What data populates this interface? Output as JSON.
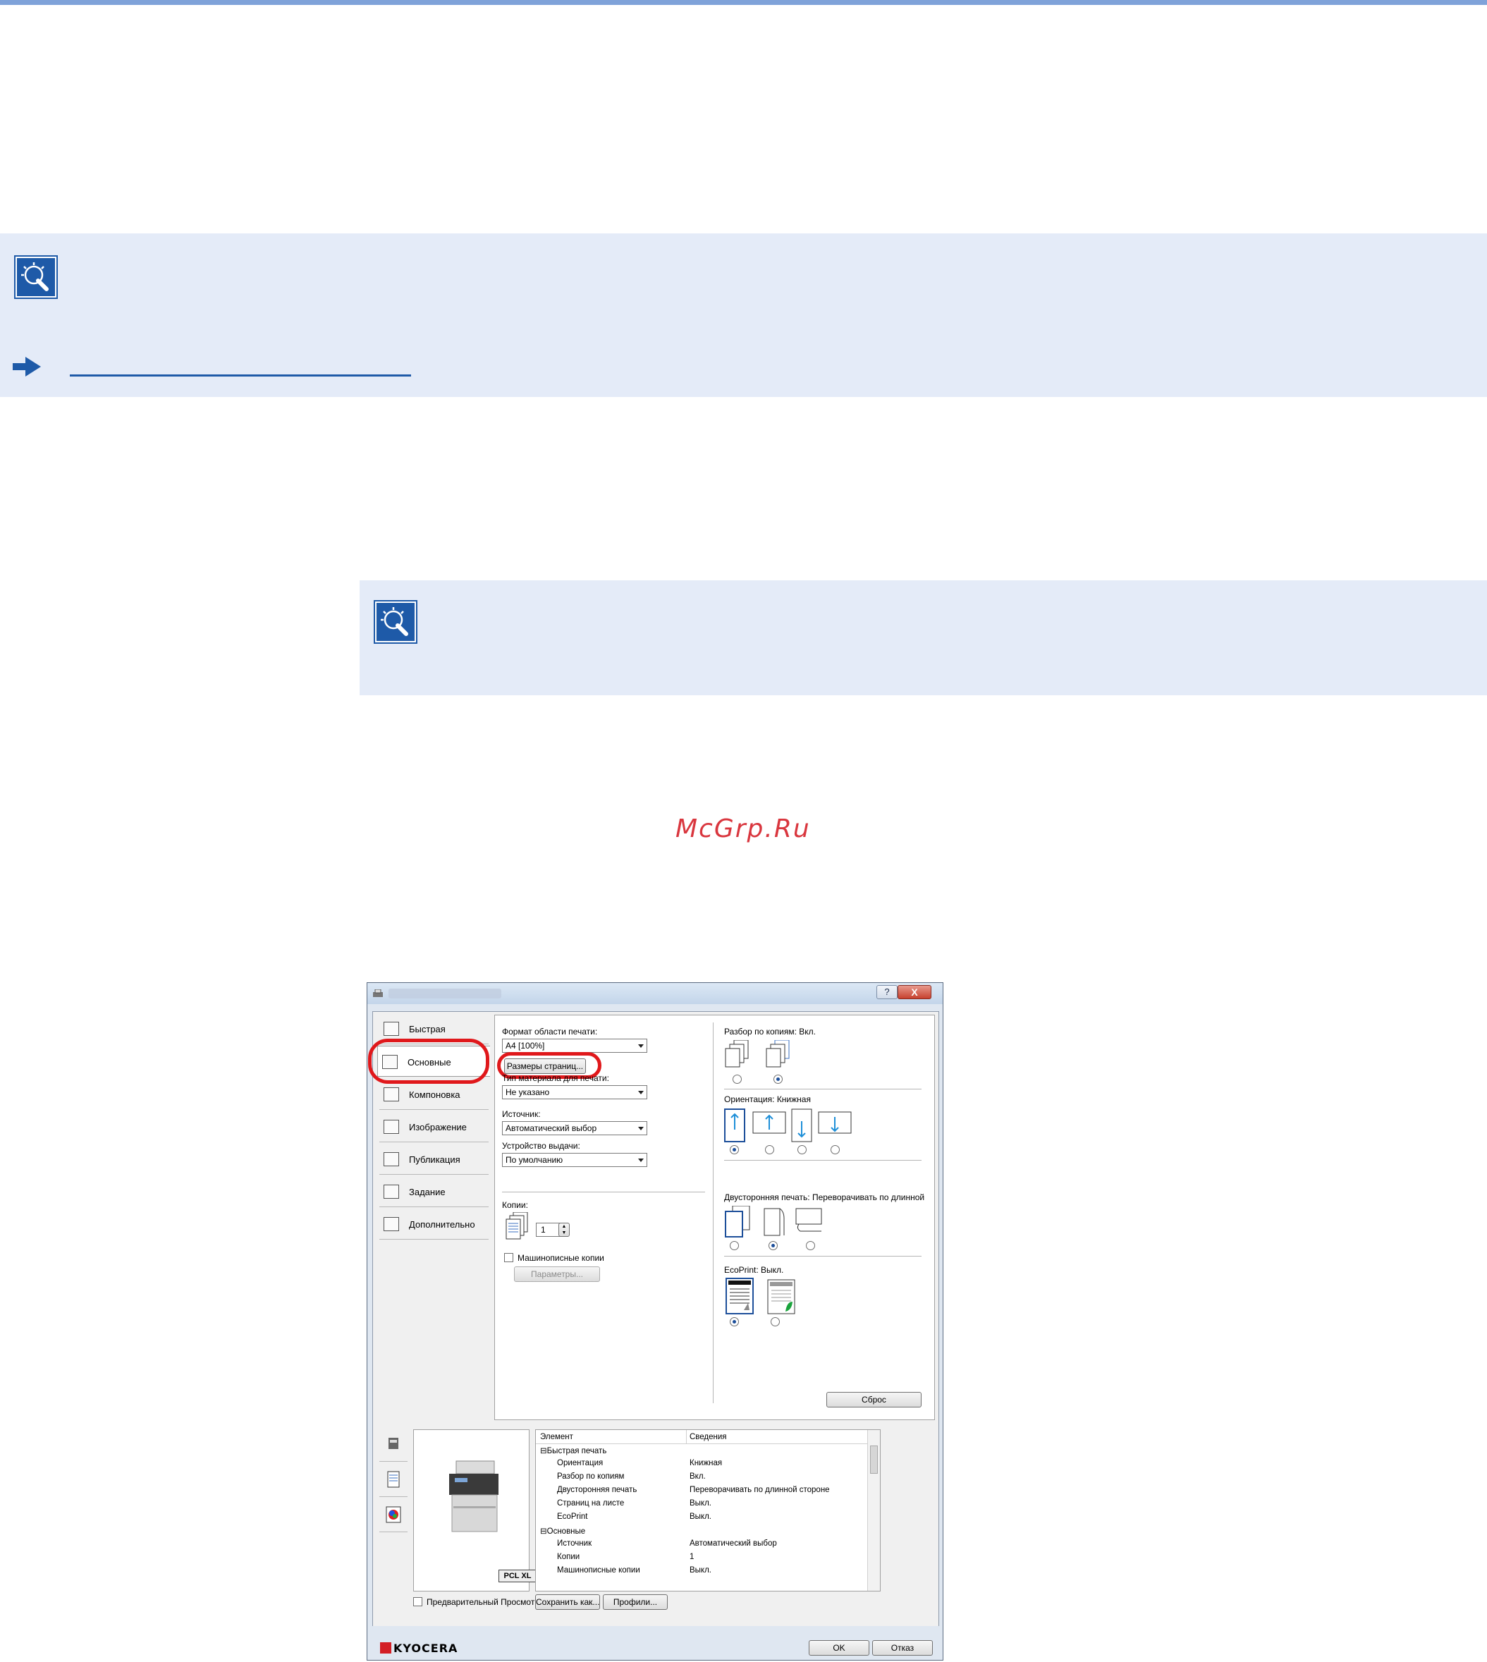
{
  "watermark": "McGrp.Ru",
  "dialog": {
    "help_btn": "?",
    "close_btn": "X",
    "tabs": [
      {
        "label": "Быстрая",
        "icon": "printer-quick-icon"
      },
      {
        "label": "Основные",
        "icon": "basic-settings-icon"
      },
      {
        "label": "Компоновка",
        "icon": "layout-icon"
      },
      {
        "label": "Изображение",
        "icon": "image-icon"
      },
      {
        "label": "Публикация",
        "icon": "publishing-icon"
      },
      {
        "label": "Задание",
        "icon": "job-icon"
      },
      {
        "label": "Дополнительно",
        "icon": "advanced-icon"
      }
    ],
    "print_size_label": "Формат области печати:",
    "print_size_value": "A4 [100%]",
    "page_sizes_btn": "Размеры страниц...",
    "media_type_label": "Тип материала для печати:",
    "media_type_value": "Не указано",
    "source_label": "Источник:",
    "source_value": "Автоматический выбор",
    "output_label": "Устройство выдачи:",
    "output_value": "По умолчанию",
    "copies_label": "Копии:",
    "copies_value": "1",
    "mopy_label": "Машинописные копии",
    "params_btn": "Параметры...",
    "collate_label": "Разбор по копиям:",
    "collate_value": "Вкл.",
    "orientation_label": "Ориентация:",
    "orientation_value": "Книжная",
    "duplex_label": "Двусторонняя печать:",
    "duplex_value": "Переворачивать по длинной",
    "ecoprint_label": "EcoPrint:",
    "ecoprint_value": "Выкл.",
    "reset_btn": "Сброс",
    "preview_badge": "PCL XL",
    "summary": {
      "col_item": "Элемент",
      "col_info": "Сведения",
      "rows": [
        {
          "item": "⊟Быстрая печать",
          "info": ""
        },
        {
          "item": "Ориентация",
          "info": "Книжная"
        },
        {
          "item": "Разбор по копиям",
          "info": "Вкл."
        },
        {
          "item": "Двусторонняя печать",
          "info": "Переворачивать по длинной стороне"
        },
        {
          "item": "Страниц на листе",
          "info": "Выкл."
        },
        {
          "item": "EcoPrint",
          "info": "Выкл."
        },
        {
          "item": "⊟Основные",
          "info": ""
        },
        {
          "item": "Источник",
          "info": "Автоматический выбор"
        },
        {
          "item": "Копии",
          "info": "1"
        },
        {
          "item": "Машинописные копии",
          "info": "Выкл."
        }
      ]
    },
    "preview_check_label": "Предварительный Просмотр",
    "save_as_btn": "Сохранить как...",
    "profiles_btn": "Профили...",
    "logo": "KYOCERA",
    "ok_btn": "OK",
    "cancel_btn": "Отказ"
  }
}
